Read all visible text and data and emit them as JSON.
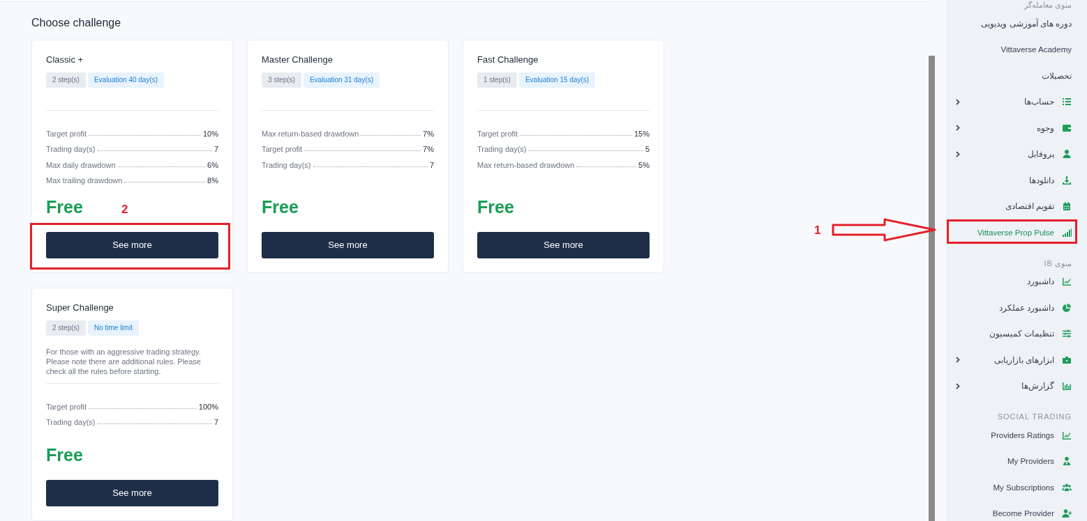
{
  "page_title": "Choose challenge",
  "cards": [
    {
      "title": "Classic +",
      "badges": [
        {
          "kind": "steps",
          "label": "2 step(s)"
        },
        {
          "kind": "period",
          "label": "Evaluation 40 day(s)"
        }
      ],
      "rules": [
        {
          "label": "Target profit",
          "value": "10%"
        },
        {
          "label": "Trading day(s)",
          "value": "7"
        },
        {
          "label": "Max daily drawdown",
          "value": "6%"
        },
        {
          "label": "Max trailing drawdown",
          "value": "8%"
        }
      ],
      "price": "Free",
      "button": "See more",
      "callout": "2"
    },
    {
      "title": "Master Challenge",
      "badges": [
        {
          "kind": "steps",
          "label": "3 step(s)"
        },
        {
          "kind": "period",
          "label": "Evaluation 31 day(s)"
        }
      ],
      "rules": [
        {
          "label": "Max return-based drawdown",
          "value": "7%"
        },
        {
          "label": "Target profit",
          "value": "7%"
        },
        {
          "label": "Trading day(s)",
          "value": "7"
        }
      ],
      "price": "Free",
      "button": "See more"
    },
    {
      "title": "Fast Challenge",
      "badges": [
        {
          "kind": "steps",
          "label": "1 step(s)"
        },
        {
          "kind": "period",
          "label": "Evaluation 15 day(s)"
        }
      ],
      "rules": [
        {
          "label": "Target profit",
          "value": "15%"
        },
        {
          "label": "Trading day(s)",
          "value": "5"
        },
        {
          "label": "Max return-based drawdown",
          "value": "5%"
        }
      ],
      "price": "Free",
      "button": "See more"
    },
    {
      "title": "Super Challenge",
      "badges": [
        {
          "kind": "steps",
          "label": "2 step(s)"
        },
        {
          "kind": "period",
          "label": "No time limit"
        }
      ],
      "description": "For those with an aggressive trading strategy. Please note there are additional rules. Please check all the rules before starting.",
      "rules": [
        {
          "label": "Target profit",
          "value": "100%"
        },
        {
          "label": "Trading day(s)",
          "value": "7"
        }
      ],
      "price": "Free",
      "button": "See more"
    }
  ],
  "sidebar": {
    "items": [
      {
        "kind": "heading",
        "label": "منوی معامله‌گر"
      },
      {
        "kind": "link",
        "label": "دوره های آموزشی ویدیویی",
        "selected": false,
        "expandable": false
      },
      {
        "kind": "link",
        "label": "Vittaverse Academy",
        "selected": false,
        "expandable": false
      },
      {
        "kind": "link",
        "label": "تحصیلات",
        "selected": false,
        "expandable": false
      },
      {
        "kind": "item",
        "label": "حساب‌ها",
        "selected": false,
        "expandable": true
      },
      {
        "kind": "item",
        "label": "وجوه",
        "selected": false,
        "expandable": true
      },
      {
        "kind": "item",
        "label": "پروفایل",
        "selected": false,
        "expandable": true
      },
      {
        "kind": "item",
        "label": "دانلودها",
        "selected": false,
        "expandable": false
      },
      {
        "kind": "item",
        "label": "تقویم اقتصادی",
        "selected": false,
        "expandable": false
      },
      {
        "kind": "item",
        "label": "Vittaverse Prop Pulse",
        "selected": true,
        "expandable": false,
        "callout": "1"
      },
      {
        "kind": "heading",
        "label": "منوی IB"
      },
      {
        "kind": "item",
        "label": "داشبورد",
        "selected": false,
        "expandable": false
      },
      {
        "kind": "item",
        "label": "داشبورد عملکرد",
        "selected": false,
        "expandable": false
      },
      {
        "kind": "item",
        "label": "تنظیمات کمیسیون",
        "selected": false,
        "expandable": false
      },
      {
        "kind": "item",
        "label": "ابزارهای بازاریابی",
        "selected": false,
        "expandable": true
      },
      {
        "kind": "item",
        "label": "گزارش‌ها",
        "selected": false,
        "expandable": true
      },
      {
        "kind": "heading",
        "label": "SOCIAL TRADING"
      },
      {
        "kind": "item",
        "label": "Providers Ratings",
        "selected": false,
        "expandable": false
      },
      {
        "kind": "item",
        "label": "My Providers",
        "selected": false,
        "expandable": false
      },
      {
        "kind": "item",
        "label": "My Subscriptions",
        "selected": false,
        "expandable": false
      },
      {
        "kind": "item",
        "label": "Become Provider",
        "selected": false,
        "expandable": false
      }
    ]
  }
}
